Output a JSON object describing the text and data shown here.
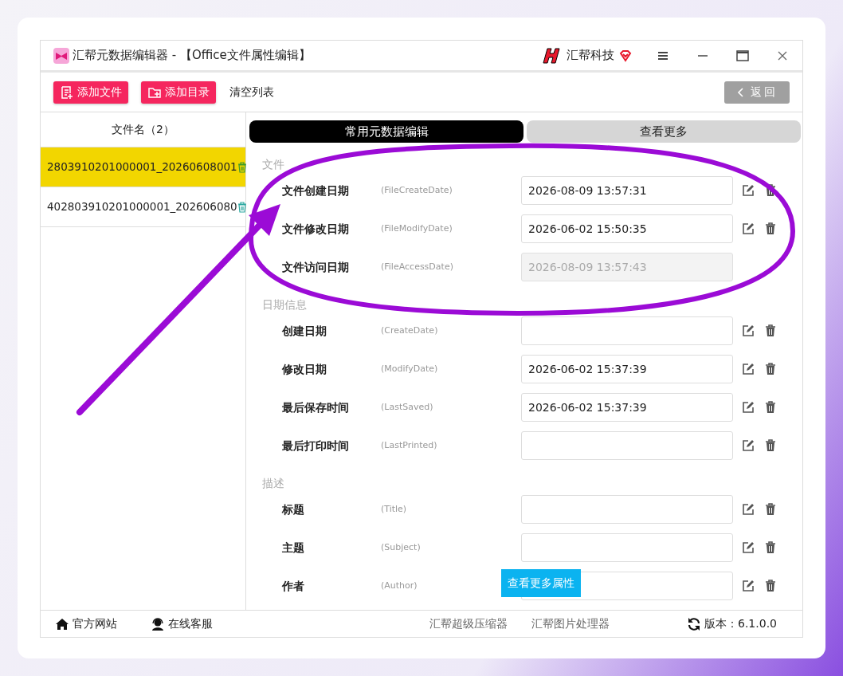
{
  "window": {
    "title": "汇帮元数据编辑器 - 【Office文件属性编辑】",
    "brand": "汇帮科技"
  },
  "toolbar": {
    "buttons": [
      {
        "label": "添加文件",
        "kind": "file"
      },
      {
        "label": "添加目录",
        "kind": "folder"
      }
    ],
    "clear": "清空列表",
    "back": "返回"
  },
  "file_list": {
    "header": "文件名（2）",
    "items": [
      {
        "name": "2803910201000001_20260608001",
        "selected": true
      },
      {
        "name": "402803910201000001_202606080",
        "selected": false
      }
    ]
  },
  "tabs": [
    {
      "label": "常用元数据编辑",
      "selected": true
    },
    {
      "label": "查看更多",
      "selected": false
    }
  ],
  "sections": [
    {
      "title": "文件",
      "fields": [
        {
          "label": "文件创建日期",
          "key": "(FileCreateDate)",
          "value": "2026-08-09 13:57:31",
          "disabled": false
        },
        {
          "label": "文件修改日期",
          "key": "(FileModifyDate)",
          "value": "2026-06-02 15:50:35",
          "disabled": false
        },
        {
          "label": "文件访问日期",
          "key": "(FileAccessDate)",
          "value": "2026-08-09 13:57:43",
          "disabled": true
        }
      ]
    },
    {
      "title": "日期信息",
      "fields": [
        {
          "label": "创建日期",
          "key": "(CreateDate)",
          "disabled": false
        },
        {
          "label": "修改日期",
          "key": "(ModifyDate)",
          "value": "2026-06-02 15:37:39",
          "disabled": false
        },
        {
          "label": "最后保存时间",
          "key": "(LastSaved)",
          "value": "2026-06-02 15:37:39",
          "disabled": false
        },
        {
          "label": "最后打印时间",
          "key": "(LastPrinted)",
          "disabled": false
        }
      ]
    },
    {
      "title": "描述",
      "fields": [
        {
          "label": "标题",
          "key": "(Title)",
          "disabled": false
        },
        {
          "label": "主题",
          "key": "(Subject)",
          "disabled": false
        },
        {
          "label": "作者",
          "key": "(Author)",
          "disabled": false
        }
      ]
    }
  ],
  "more_button": "查看更多属性",
  "status_bar": {
    "links": [
      {
        "label": "官方网站",
        "kind": "home"
      },
      {
        "label": "在线客服",
        "kind": "support"
      }
    ],
    "apps": [
      "汇帮超级压缩器",
      "汇帮图片处理器"
    ],
    "version": "版本：6.1.0.0"
  }
}
